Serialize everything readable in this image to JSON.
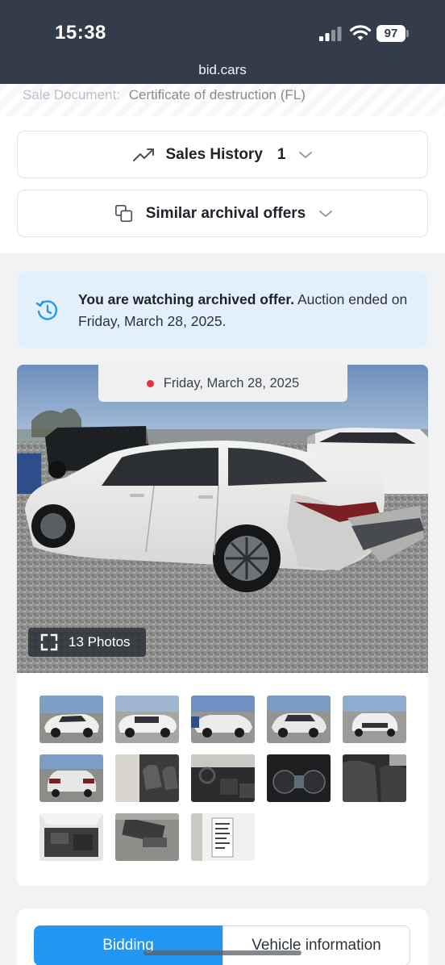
{
  "status_bar": {
    "time": "15:38",
    "battery": "97",
    "url": "bid.cars"
  },
  "sale_document": {
    "label": "Sale Document:",
    "value": "Certificate of destruction (FL)"
  },
  "sales_history": {
    "label": "Sales History",
    "count": "1",
    "icon": "trending-up-icon"
  },
  "similar_offers": {
    "label": "Similar archival offers",
    "icon": "copy-icon"
  },
  "archive_notice": {
    "bold": "You are watching archived offer.",
    "rest": "Auction ended on Friday, March 28, 2025."
  },
  "gallery": {
    "date": "Friday, March 28, 2025",
    "photos_label": "13 Photos",
    "thumbnails": [
      "Front left view",
      "Side view",
      "Left side view",
      "Front view",
      "Front view close",
      "Rear view",
      "Interior front seats",
      "Dashboard",
      "Instrument cluster",
      "Rear seats",
      "Engine bay",
      "Undercarriage",
      "Door label"
    ]
  },
  "tabs": {
    "bidding": "Bidding",
    "vehicle_info": "Vehicle information"
  },
  "colors": {
    "accent": "#2196f3",
    "status_bar": "#333d49",
    "notice_bg": "#e3f0fb",
    "date_dot": "#e0333a"
  }
}
